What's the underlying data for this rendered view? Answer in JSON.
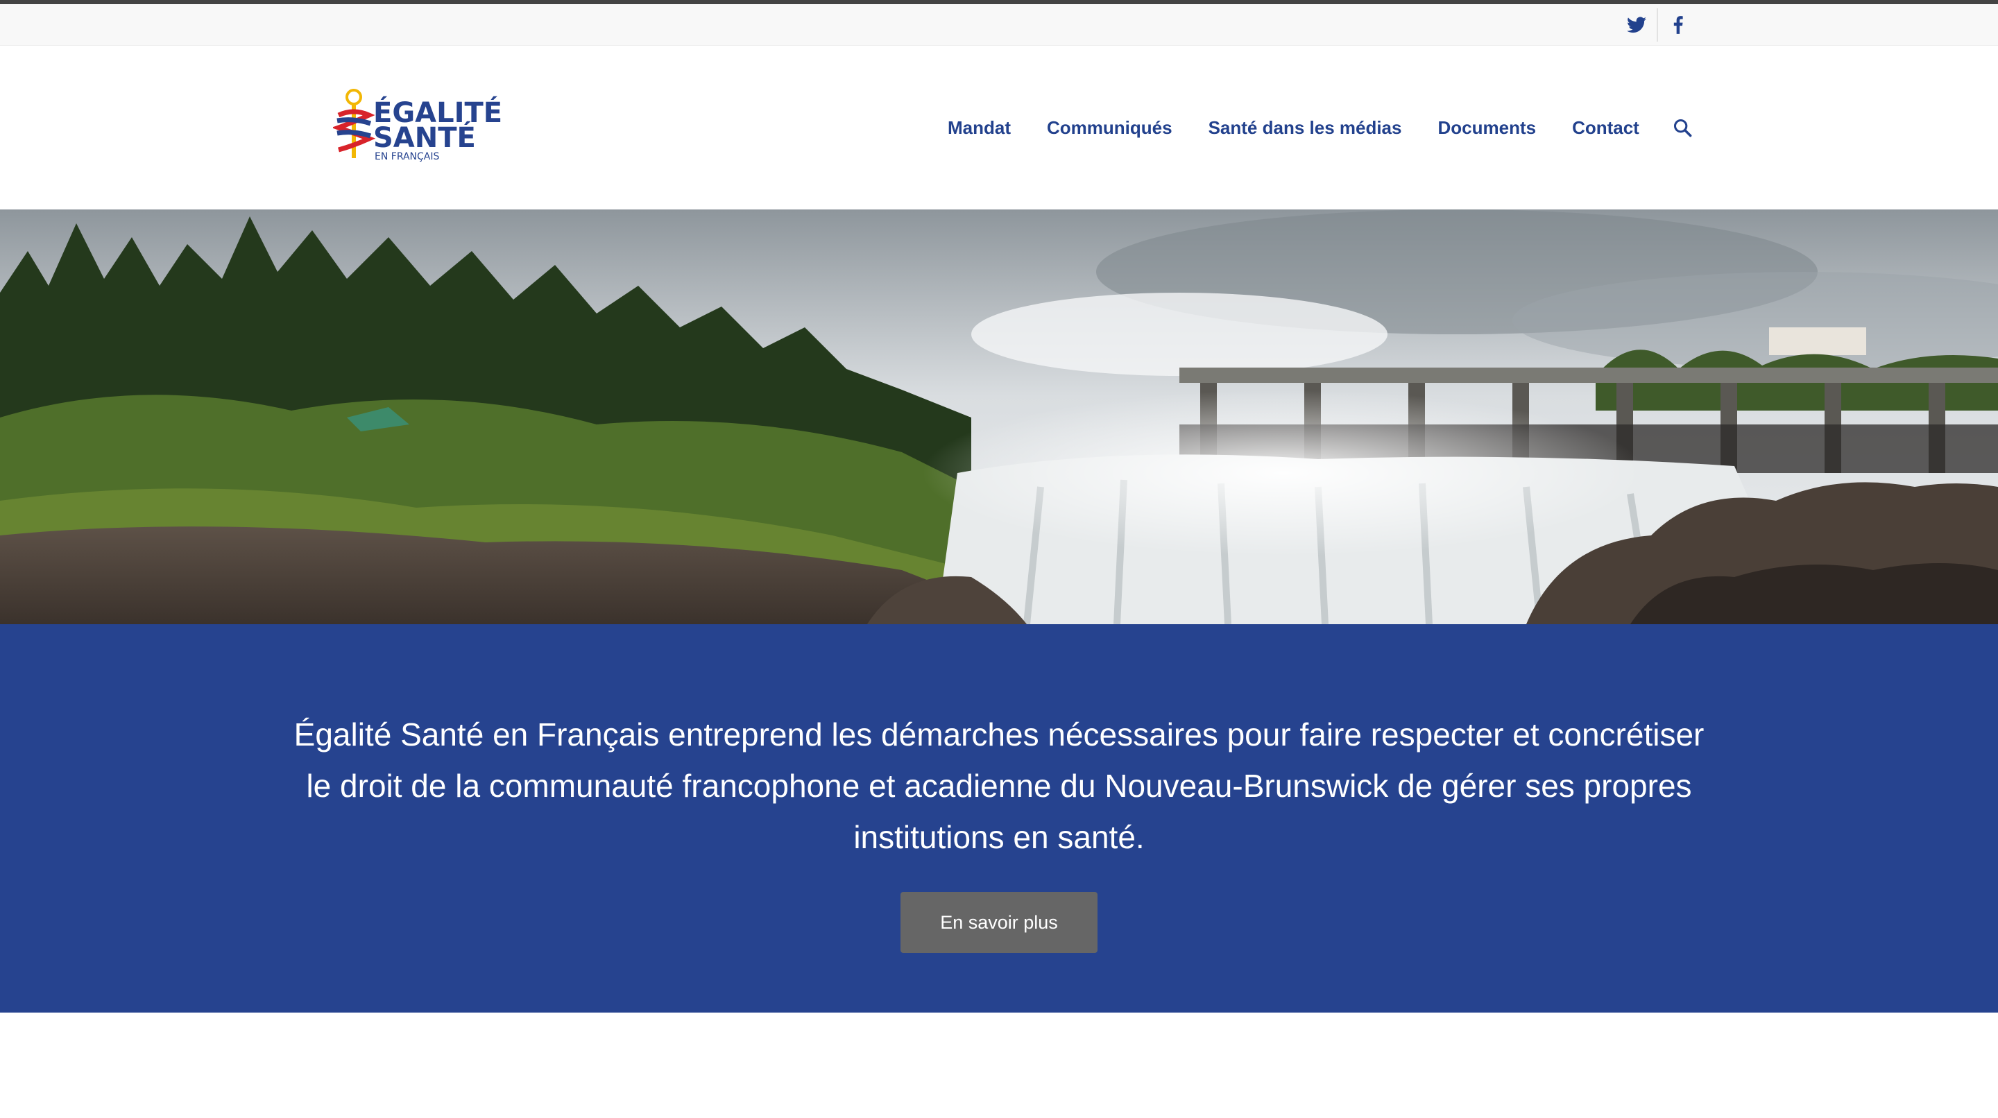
{
  "brand": {
    "logo_line1": "ÉGALITÉ",
    "logo_line2": "SANTÉ",
    "logo_line3": "EN FRANÇAIS",
    "color_primary": "#26438f",
    "color_nav": "#22418d",
    "color_accent_red": "#d8232a",
    "color_accent_yellow": "#f2b705"
  },
  "social": {
    "items": [
      {
        "icon": "twitter-icon"
      },
      {
        "icon": "facebook-icon"
      }
    ]
  },
  "nav": {
    "items": [
      {
        "label": "Mandat"
      },
      {
        "label": "Communiqués"
      },
      {
        "label": "Santé dans les médias"
      },
      {
        "label": "Documents"
      },
      {
        "label": "Contact"
      }
    ],
    "search_icon": "search-icon"
  },
  "intro": {
    "text": "Égalité Santé en Français entreprend les démarches nécessaires pour faire respecter et concrétiser le droit de la communauté francophone et acadienne du Nouveau-Brunswick de gérer ses propres institutions en santé.",
    "cta_label": "En savoir plus"
  }
}
